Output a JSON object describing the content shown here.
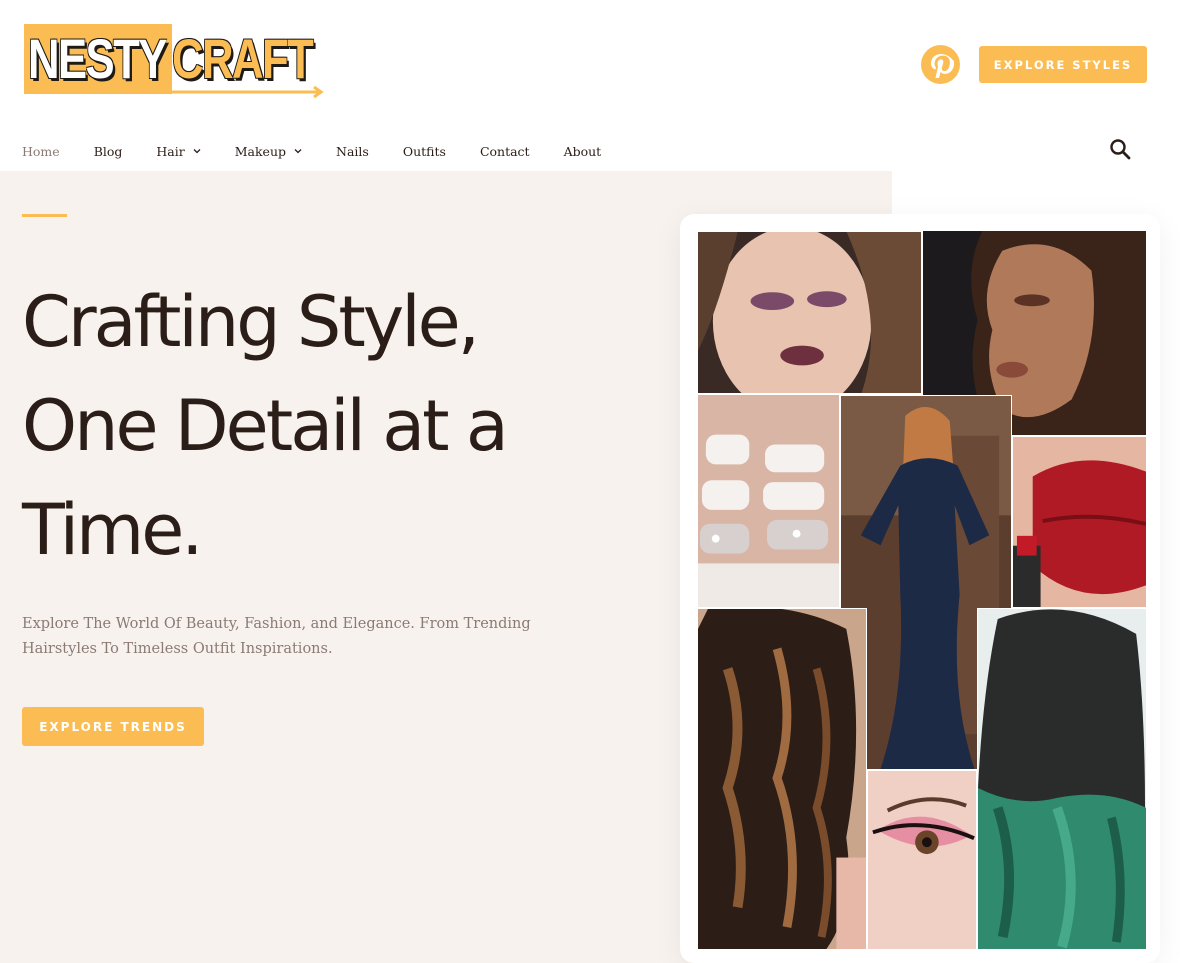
{
  "logo": {
    "part1": "NESTY",
    "part2": "CRAFT"
  },
  "header": {
    "cta_label": "EXPLORE STYLES"
  },
  "nav": {
    "items": [
      {
        "label": "Home",
        "dropdown": false,
        "active": true
      },
      {
        "label": "Blog",
        "dropdown": false,
        "active": false
      },
      {
        "label": "Hair",
        "dropdown": true,
        "active": false
      },
      {
        "label": "Makeup",
        "dropdown": true,
        "active": false
      },
      {
        "label": "Nails",
        "dropdown": false,
        "active": false
      },
      {
        "label": "Outfits",
        "dropdown": false,
        "active": false
      },
      {
        "label": "Contact",
        "dropdown": false,
        "active": false
      },
      {
        "label": "About",
        "dropdown": false,
        "active": false
      }
    ]
  },
  "hero": {
    "headline_lines": [
      "Crafting Style,",
      "One Detail at a",
      "Time."
    ],
    "subtext": "Explore The World Of Beauty, Fashion, and Elegance. From Trending Hairstyles To Timeless Outfit Inspirations.",
    "cta_label": "EXPLORE TRENDS"
  },
  "icons": {
    "pinterest": "pinterest-icon",
    "search": "search-icon",
    "chevron": "chevron-down-icon"
  },
  "colors": {
    "accent": "#fbbd53",
    "text_dark": "#2b1d17",
    "text_muted": "#8a7a73",
    "hero_bg": "#f8f2ee"
  }
}
